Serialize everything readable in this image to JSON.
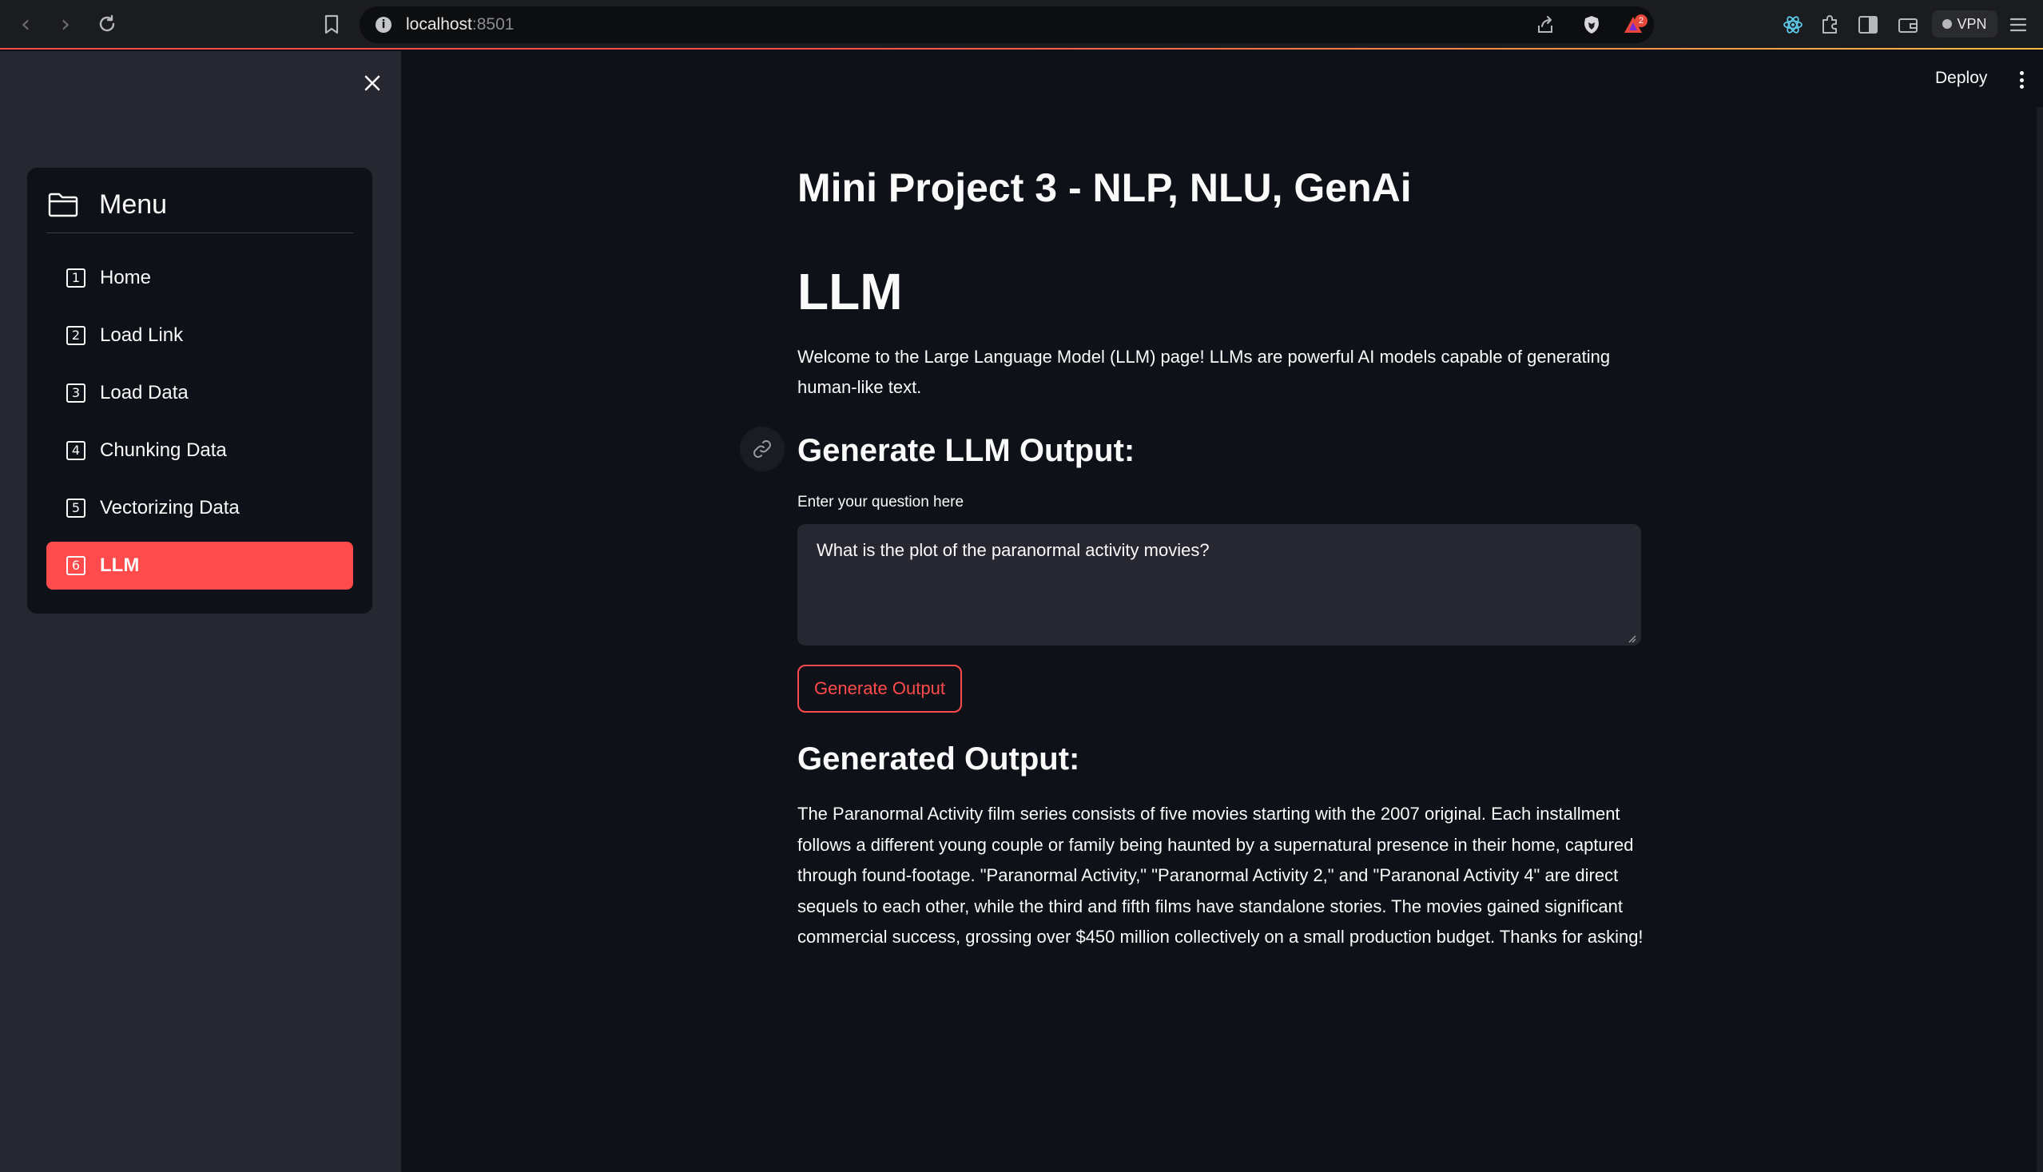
{
  "browser": {
    "url_host": "localhost",
    "url_port": ":8501",
    "brave_badge_count": "2",
    "vpn_label": "VPN"
  },
  "sidebar": {
    "menu_title": "Menu",
    "items": [
      {
        "num": "1",
        "label": "Home"
      },
      {
        "num": "2",
        "label": "Load Link"
      },
      {
        "num": "3",
        "label": "Load Data"
      },
      {
        "num": "4",
        "label": "Chunking Data"
      },
      {
        "num": "5",
        "label": "Vectorizing Data"
      },
      {
        "num": "6",
        "label": "LLM"
      }
    ],
    "active_index": 5,
    "accent_color": "#ff4b4b"
  },
  "header": {
    "deploy_label": "Deploy"
  },
  "main": {
    "app_title": "Mini Project 3 - NLP, NLU, GenAi",
    "page_heading": "LLM",
    "intro": "Welcome to the Large Language Model (LLM) page! LLMs are powerful AI models capable of generating human-like text.",
    "generate_heading": "Generate LLM Output:",
    "question_label": "Enter your question here",
    "question_value": "What is the plot of the paranormal activity movies?",
    "generate_button": "Generate Output",
    "output_heading": "Generated Output:",
    "output_text": "The Paranormal Activity film series consists of five movies starting with the 2007 original. Each installment follows a different young couple or family being haunted by a supernatural presence in their home, captured through found-footage. \"Paranormal Activity,\" \"Paranormal Activity 2,\" and \"Paranonal Activity 4\" are direct sequels to each other, while the third and fifth films have standalone stories. The movies gained significant commercial success, grossing over $450 million collectively on a small production budget. Thanks for asking!"
  }
}
